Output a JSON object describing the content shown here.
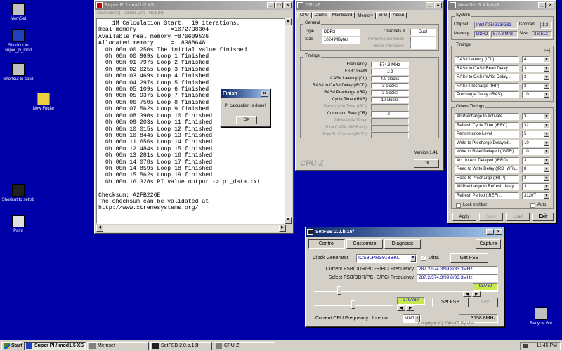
{
  "desktop": {
    "icons": [
      {
        "label": "MemSet",
        "color": "#c0c0c0"
      },
      {
        "label": "Shortcut to super_pi_mod",
        "color": "#2040c0"
      },
      {
        "label": "Shortcut to cpuz",
        "color": "#c0c0c0"
      },
      {
        "label": "New Folder",
        "color": "#f0d040"
      },
      {
        "label": "Shortcut to setfsb",
        "color": "#202020"
      },
      {
        "label": "Paint",
        "color": "#e0e0e0"
      },
      {
        "label": "Recycle Bin",
        "color": "#c0c0c0"
      }
    ]
  },
  "superpi": {
    "title": "Super PI / mod1.5 XS",
    "menu": [
      "Calculate(C)",
      "About...(A)",
      "Help(H)"
    ],
    "lines": [
      "    1M Calculation Start.  19 iterations.",
      "Real memory          =1072738304",
      "Available real memory =876609536",
      "Allocated memory     =  8388648",
      "  0h 00m 00.250s The initial value finished",
      "  0h 00m 00.969s Loop 1 finished",
      "  0h 00m 01.797s Loop 2 finished",
      "  0h 00m 02.625s Loop 3 finished",
      "  0h 00m 03.469s Loop 4 finished",
      "  0h 00m 04.297s Loop 5 finished",
      "  0h 00m 05.109s Loop 6 finished",
      "  0h 00m 05.937s Loop 7 finished",
      "  0h 00m 06.750s Loop 8 finished",
      "  0h 00m 07.562s Loop 9 finished",
      "  0h 00m 08.390s Loop 10 finished",
      "  0h 00m 09.203s Loop 11 finished",
      "  0h 00m 10.015s Loop 12 finished",
      "  0h 00m 10.844s Loop 13 finished",
      "  0h 00m 11.656s Loop 14 finished",
      "  0h 00m 12.484s Loop 15 finished",
      "  0h 00m 13.281s Loop 16 finished",
      "  0h 00m 14.078s Loop 17 finished",
      "  0h 00m 14.859s Loop 18 finished",
      "  0h 00m 15.562s Loop 19 finished",
      "  0h 00m 16.328s PI value output -> pi_data.txt",
      "",
      "Checksum: A2FB226E",
      "The checksum can be validated at",
      "http://www.xtremesystems.org/"
    ]
  },
  "finish_dialog": {
    "title": "Finish",
    "message": "PI calculation is done!",
    "ok": "OK"
  },
  "cpuz": {
    "title": "CPU-Z",
    "tabs": [
      "CPU",
      "Cache",
      "Mainboard",
      "Memory",
      "SPD",
      "About"
    ],
    "active_tab": "Memory",
    "general_title": "General",
    "type_label": "Type",
    "type_value": "DDR2",
    "channels_label": "Channels #",
    "channels_value": "Dual",
    "size_label": "Size",
    "size_value": "1024 MBytes",
    "perf_mode_label": "Performance Mode",
    "bank_interleave_label": "Bank Interleave",
    "timings_title": "Timings",
    "timings": [
      {
        "label": "Frequency",
        "value": "574.3 MHz",
        "dim": false
      },
      {
        "label": "FSB:DRAM",
        "value": "1:2",
        "dim": false
      },
      {
        "label": "CAS# Latency (CL)",
        "value": "4.0 clocks",
        "dim": false
      },
      {
        "label": "RAS# to CAS# Delay (tRCD)",
        "value": "3 clocks",
        "dim": false
      },
      {
        "label": "RAS# Precharge (tRP)",
        "value": "3 clocks",
        "dim": false
      },
      {
        "label": "Cycle Time (tRAS)",
        "value": "10 clocks",
        "dim": false
      },
      {
        "label": "Bank Cycle Time (tRC)",
        "value": "",
        "dim": true
      },
      {
        "label": "Command Rate (CR)",
        "value": "2T",
        "dim": false
      },
      {
        "label": "DRAM Idle Timer",
        "value": "",
        "dim": true
      },
      {
        "label": "Total CAS# (tRDRAM)",
        "value": "",
        "dim": true
      },
      {
        "label": "Row To Column (tRCD)",
        "value": "",
        "dim": true
      }
    ],
    "version": "Version 1.41",
    "brand": "CPU-Z",
    "ok": "OK"
  },
  "memset": {
    "title": "MemSet 3.4 beta2",
    "system_title": "System",
    "chipset_label": "Chipset",
    "chipset_value": "Intel P35/G33/G31",
    "fsb_dram_label": "fsb/dram",
    "fsb_dram_value": "1:2",
    "memory_label": "Memory",
    "memory_type": "DDR2",
    "memory_freq": "574.3 Mhz",
    "size_label": "Size",
    "size_value": "2 x 512",
    "timings_title": "Timings",
    "expand": ">>|",
    "timings": [
      {
        "label": "CAS# Latency (tCL)",
        "value": "4"
      },
      {
        "label": "RAS# to CAS# Read Delay...",
        "value": "3"
      },
      {
        "label": "RAS# to CAS# Write Delay...",
        "value": "3"
      },
      {
        "label": "RAS# Precharge (tRP)",
        "value": "3"
      },
      {
        "label": "Precharge Delay  (tRAS)",
        "value": "10"
      }
    ],
    "other_title": "Others Timings",
    "others": [
      {
        "label": "All Precharge to Activate...",
        "value": "3"
      },
      {
        "label": "Refresh Cycle Time (tRFC)",
        "value": "32"
      },
      {
        "label": "Performance Level",
        "value": "5"
      },
      {
        "label": "Write to Precharge Delayed...",
        "value": "10"
      },
      {
        "label": "Write to Read Delayed (tWTR)...",
        "value": "10"
      },
      {
        "label": "Act. to Act. Delayed (tRRD)...",
        "value": "3"
      },
      {
        "label": "Read to Write Delay (tRD_WR)...",
        "value": "8"
      },
      {
        "label": "Read to Precharge (tRTP)",
        "value": "3"
      },
      {
        "label": "All Precharge to Refresh delay...",
        "value": "3"
      },
      {
        "label": "Refresh Period (tREF)...",
        "value": "3120T"
      }
    ],
    "lock_label": "Lock mchbar",
    "auto_label": "Auto",
    "apply": "Apply",
    "save": "Save",
    "load": "Load",
    "exit": "Exit"
  },
  "setfsb": {
    "title": "SetFSB 2.0.b.15f",
    "tabs": [
      "Control",
      "Customize",
      "Diagnosis"
    ],
    "capture": "Capture",
    "clock_gen_label": "Clock Generator",
    "clock_gen_value": "ICS9LPRS918BKL",
    "ultra_label": "Ultra",
    "get_fsb": "Get FSB",
    "current_label": "Current FSB/DDR/PCI-E/PCI Frequency",
    "current_value": "287.2/574.3/99.8/33.3MHz",
    "select_label": "Select FSB/DDR/PCI-E/PCI Frequency",
    "select_value": "287.2/574.3/99.8/33.3MHz",
    "slider1_value": "98/760",
    "slider1_fraction": 0.13,
    "slider2_value": "379/760",
    "slider2_fraction": 0.5,
    "set_fsb": "Set FSB",
    "auto": "Auto",
    "cpu_freq_label": "Current CPU Frequency : Internal",
    "cpu_unit": "MMT",
    "cpu_freq_value": "3158.8MHz",
    "copyright": "Copyright (C) 2001-07 By abo"
  },
  "taskbar": {
    "start": "Start",
    "tasks": [
      "Super PI / mod1.5 XS",
      "Memset",
      "SetFSB 2.0.b.15f",
      "CPU-Z"
    ],
    "clock": "11:45 PM"
  }
}
